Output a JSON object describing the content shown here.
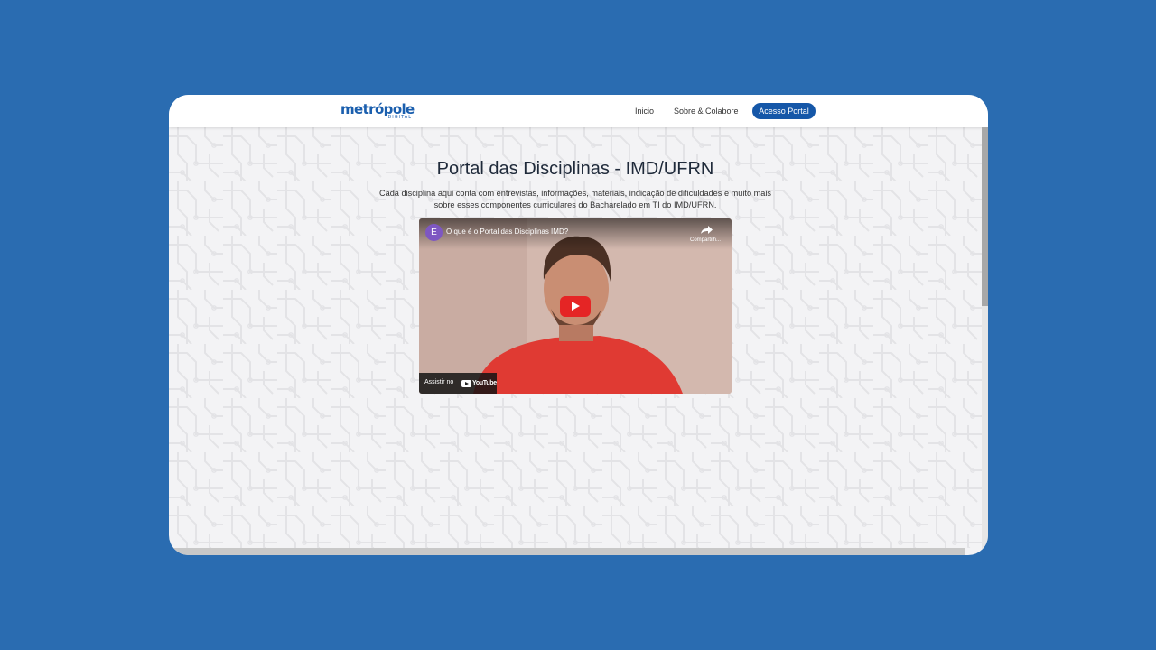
{
  "navbar": {
    "logo_text": "metrópole",
    "logo_subtext": "DIGITAL",
    "links": [
      "Inicio",
      "Sobre & Colabore"
    ],
    "portal_button": "Acesso Portal"
  },
  "hero": {
    "title": "Portal das Disciplinas - IMD/UFRN",
    "description": "Cada disciplina aqui conta com entrevistas, informações, materiais, indicação de dificuldades e muito mais sobre esses componentes curriculares do Bacharelado em TI do IMD/UFRN."
  },
  "video": {
    "channel_initial": "E",
    "title": "O que é o Portal das Disciplinas IMD?",
    "share_label": "Compartilh...",
    "watch_on_label": "Assistir no",
    "youtube_label": "YouTube"
  },
  "colors": {
    "background": "#2a6cb1",
    "brand_blue": "#1557a8",
    "youtube_red": "#e52525"
  }
}
